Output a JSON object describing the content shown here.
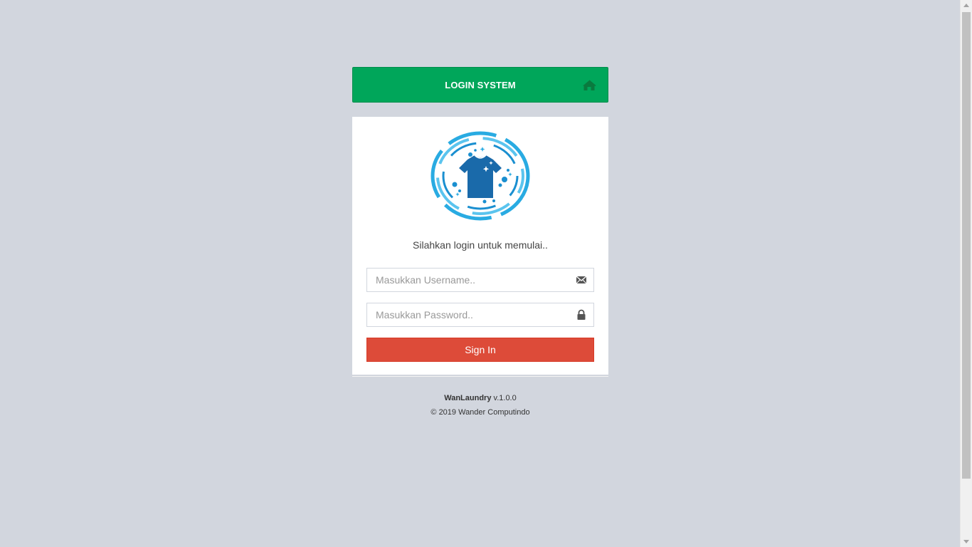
{
  "header": {
    "title": "LOGIN SYSTEM",
    "icon": "home-icon"
  },
  "colors": {
    "background": "#d2d6de",
    "header": "#00a65a",
    "signin_button": "#dd4b39",
    "logo_primary": "#1a6aaa",
    "logo_accent": "#29abe2"
  },
  "logo": {
    "icon": "laundry-shirt-logo"
  },
  "login": {
    "message": "Silahkan login untuk memulai..",
    "username_placeholder": "Masukkan Username..",
    "username_icon": "envelope-icon",
    "password_placeholder": "Masukkan Password..",
    "password_icon": "lock-icon",
    "signin_label": "Sign In"
  },
  "footer": {
    "app_name": "WanLaundry",
    "version": " v.1.0.0",
    "copyright": "© 2019 Wander Computindo"
  }
}
